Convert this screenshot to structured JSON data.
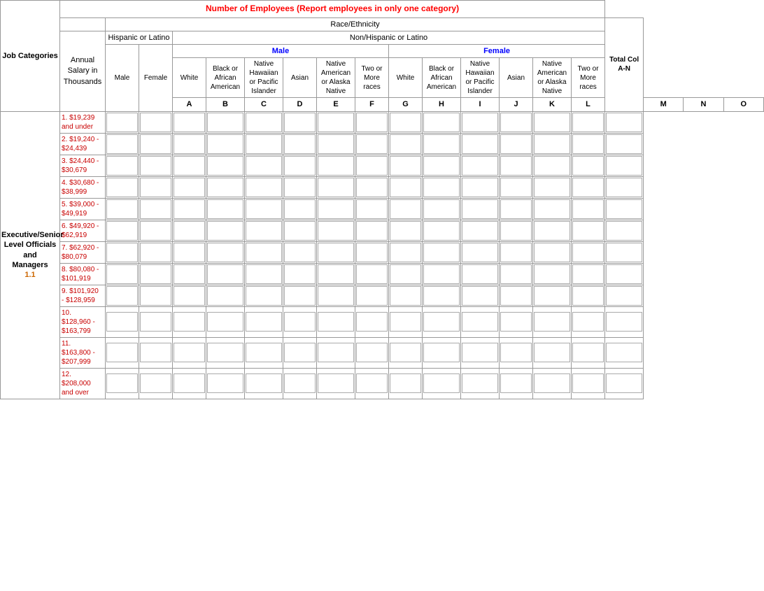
{
  "title": "Number of Employees (Report employees in only one category)",
  "race_ethnicity": "Race/Ethnicity",
  "non_hispanic": "Non/Hispanic or Latino",
  "hispanic_label": "Hispanic or Latino",
  "male_label": "Male",
  "female_label": "Female",
  "total_col_label": "Total Col A-N",
  "annual_salary_label": "Annual\nSalary in\nThousands",
  "job_categories_label": "Job Categories",
  "columns": {
    "a": "A",
    "b": "B",
    "c": "C",
    "d": "D",
    "e": "E",
    "f": "F",
    "g": "G",
    "h": "H",
    "i": "I",
    "j": "J",
    "k": "K",
    "l": "L",
    "m": "M",
    "n": "N",
    "o": "O"
  },
  "col_headers": {
    "male_col": "Male",
    "female_col": "Female",
    "white": "White",
    "black_african": "Black or\nAfrican\nAmerican",
    "native_hawaiian": "Native\nHawaiian\nor Pacific\nIslander",
    "asian": "Asian",
    "native_american": "Native\nAmerican\nor Alaska\nNative",
    "two_or_more": "Two or\nMore\nraces",
    "white_f": "White",
    "black_african_f": "Black or\nAfrican\nAmerican",
    "native_hawaiian_f": "Native\nHawaiian\nor Pacific\nIslander",
    "asian_f": "Asian",
    "native_american_f": "Native\nAmerican\nor Alaska\nNative",
    "two_or_more_f": "Two or\nMore\nraces"
  },
  "salary_ranges": [
    {
      "id": 1,
      "label": "1. $19,239\nand under"
    },
    {
      "id": 2,
      "label": "2. $19,240 -\n$24,439"
    },
    {
      "id": 3,
      "label": "3. $24,440 -\n$30,679"
    },
    {
      "id": 4,
      "label": "4. $30,680 -\n$38,999"
    },
    {
      "id": 5,
      "label": "5. $39,000 -\n$49,919"
    },
    {
      "id": 6,
      "label": "6. $49,920 -\n$62,919"
    },
    {
      "id": 7,
      "label": "7. $62,920 -\n$80,079"
    },
    {
      "id": 8,
      "label": "8. $80,080 -\n$101,919"
    },
    {
      "id": 9,
      "label": "9. $101,920\n- $128,959"
    },
    {
      "id": 10,
      "label": "10.\n$128,960 -\n$163,799"
    },
    {
      "id": 11,
      "label": "11.\n$163,800 -\n$207,999"
    },
    {
      "id": 12,
      "label": "12.\n$208,000\nand over"
    }
  ],
  "job_category": {
    "name": "Executive/Senior\nLevel Officials and\nManagers",
    "number": "1.1"
  }
}
